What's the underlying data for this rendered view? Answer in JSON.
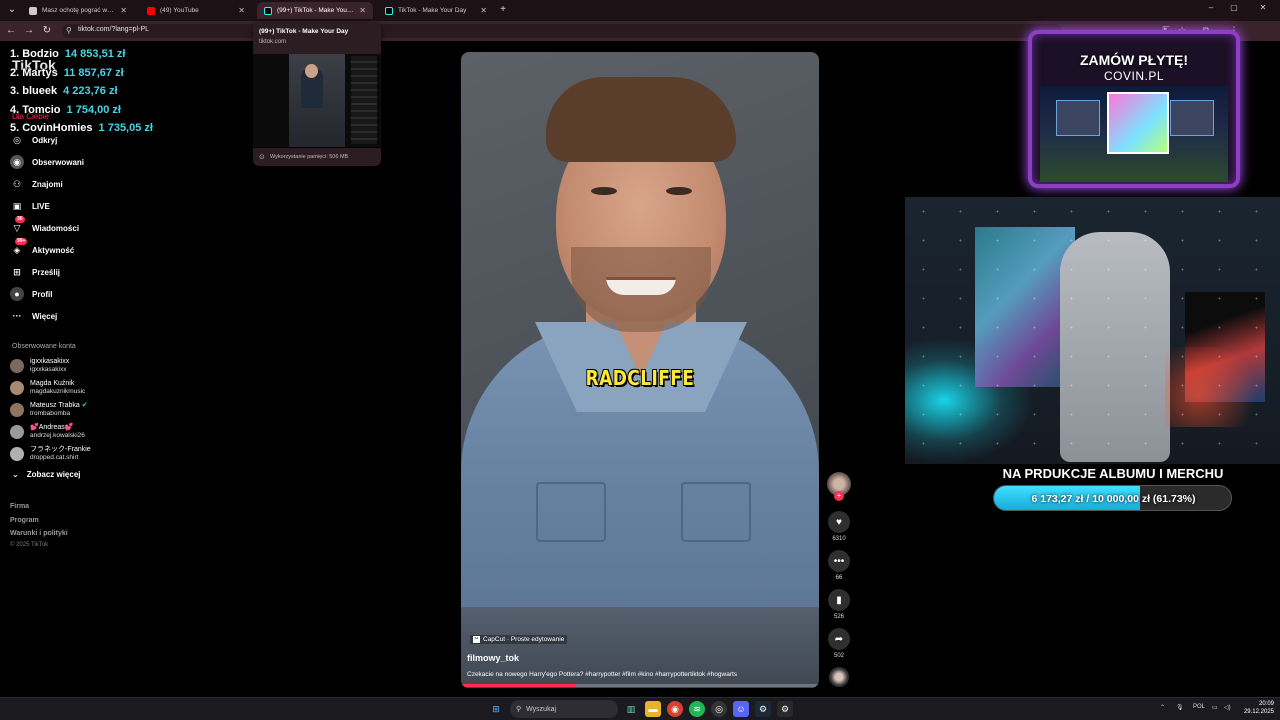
{
  "browser": {
    "tabs": [
      {
        "title": "Masz ochotę pograć w gry Mul",
        "favicon_color": "#cccccc",
        "active": false
      },
      {
        "title": "(49) YouTube",
        "favicon_color": "#ff0000",
        "active": false
      },
      {
        "title": "(99+) TikTok - Make Your Day",
        "favicon_color": "#000000",
        "active": true
      },
      {
        "title": "TikTok - Make Your Day",
        "favicon_color": "#000000",
        "active": false
      }
    ],
    "url": "tiktok.com/?lang=pl-PL",
    "tab_preview": {
      "title": "(99+) TikTok - Make Your Day",
      "domain": "tiktok.com",
      "memory": "Wykorzystanie pamięci: 506 MB"
    }
  },
  "leaderboard": [
    {
      "rank_name": "1. Bodzio",
      "amount": "14 853,51 zł"
    },
    {
      "rank_name": "2. Martys",
      "amount": "11 857,67 zł"
    },
    {
      "rank_name": "3. blueek",
      "amount": "4 223,76 zł"
    },
    {
      "rank_name": "4. Tomcio",
      "amount": "1 754,00 zł"
    },
    {
      "rank_name": "5. CovinHomies",
      "amount": "1 735,05 zł"
    }
  ],
  "tiktok": {
    "logo": "TikTok",
    "for_you": "Dla Ciebie",
    "nav": [
      {
        "label": "Odkryj",
        "icon": "compass-icon",
        "glyph": "◎"
      },
      {
        "label": "Obserwowani",
        "icon": "following-icon",
        "glyph": "◉"
      },
      {
        "label": "Znajomi",
        "icon": "friends-icon",
        "glyph": "⚇"
      },
      {
        "label": "LIVE",
        "icon": "live-icon",
        "glyph": "▣"
      },
      {
        "label": "Wiadomości",
        "icon": "messages-icon",
        "glyph": "▽",
        "badge": "36"
      },
      {
        "label": "Aktywność",
        "icon": "activity-icon",
        "glyph": "◈",
        "badge": "99+"
      },
      {
        "label": "Prześlij",
        "icon": "upload-icon",
        "glyph": "⊞"
      },
      {
        "label": "Profil",
        "icon": "profile-icon",
        "glyph": "●"
      },
      {
        "label": "Więcej",
        "icon": "more-icon",
        "glyph": "···"
      }
    ],
    "followed_title": "Obserwowane konta",
    "followed": [
      {
        "name": "igxxkasakixx",
        "handle": "igxxkasakixx"
      },
      {
        "name": "Magda Kuźnik",
        "handle": "magdakuznikmusic"
      },
      {
        "name": "Mateusz Trabka",
        "handle": "trombabomba",
        "verified": true
      },
      {
        "name": "💕Andreas💕",
        "handle": "andrzej.kowalski26"
      },
      {
        "name": "フラネック-Frankie",
        "handle": "dropped.cat.shirt"
      }
    ],
    "see_more": "Zobacz więcej",
    "footer_links": [
      "Firma",
      "Program",
      "Warunki i polityki"
    ],
    "copyright": "© 2025 TikTok"
  },
  "video": {
    "caption": "RADCLIFFE",
    "capcut_label": "CapCut · Proste edytowanie",
    "author": "filmowy_tok",
    "description": "Czekacie na nowego Harry'ego Pottera? #harrypotter #film #kino #harrypottertiktok #hogwarts",
    "progress_fraction": 0.32,
    "likes": "6310",
    "comments": "66",
    "saves": "526",
    "shares": "502"
  },
  "stream_overlay": {
    "album_title": "ZAMÓW PŁYTĘ!",
    "album_site": "COVIN.PL",
    "goal_title": "NA PRDUKCJE ALBUMU I MERCHU",
    "goal_text": "6 173,27 zł / 10 000,00 zł (61.73%)",
    "goal_fraction": 0.6173,
    "accent": "#48d4e8"
  },
  "taskbar": {
    "search_placeholder": "Wyszukaj",
    "language": "POL",
    "time": "20:09",
    "date": "29.12.2025"
  }
}
